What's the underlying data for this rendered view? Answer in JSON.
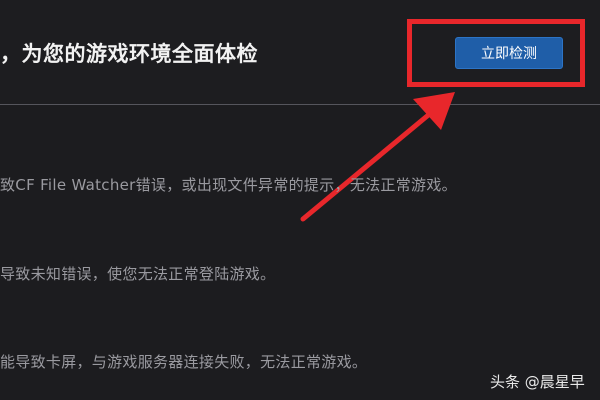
{
  "header": {
    "title": "，为您的游戏环境全面体检",
    "check_button_label": "立即检测"
  },
  "issues": [
    "致CF File Watcher错误，或出现文件异常的提示，无法正常游戏。",
    "导致未知错误，使您无法正常登陆游戏。",
    "能导致卡屏，与游戏服务器连接失败，无法正常游戏。"
  ],
  "annotation": {
    "highlight_color": "#e8272b"
  },
  "watermark": {
    "text": "头条 @晨星早"
  },
  "colors": {
    "background": "#1c1c1f",
    "button": "#1f5ea8",
    "text_muted": "#9a9aa0"
  }
}
